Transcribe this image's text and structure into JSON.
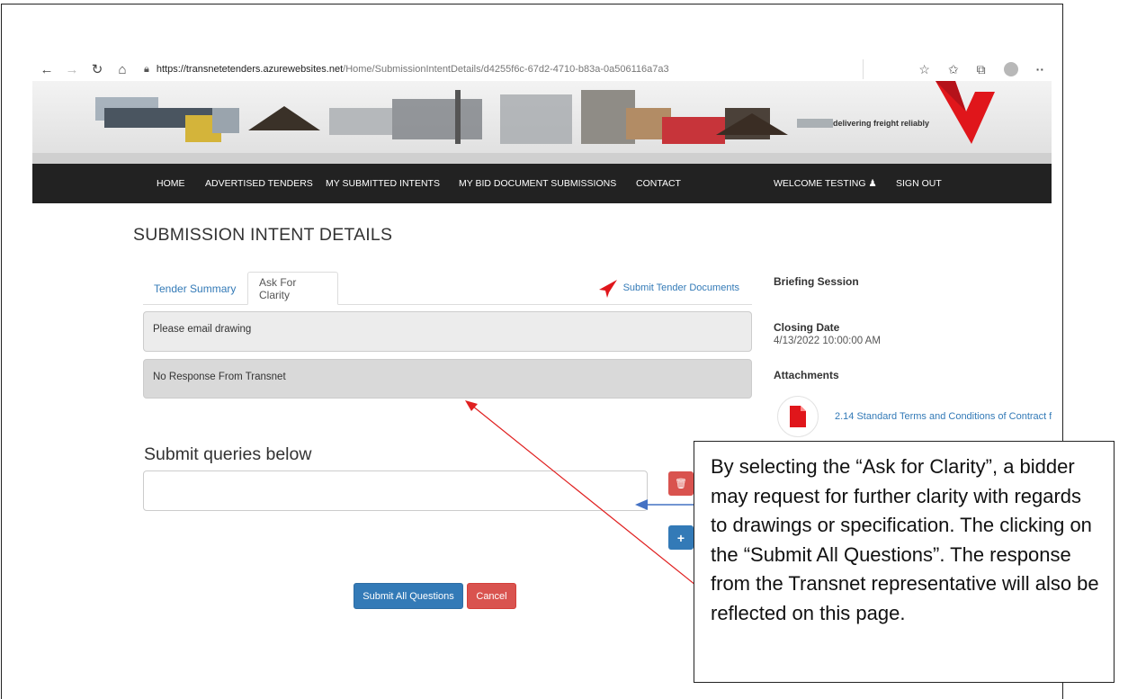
{
  "browser": {
    "url_host": "https://transnetetenders.azurewebsites.net",
    "url_path": "/Home/SubmissionIntentDetails/d4255f6c-67d2-4710-b83a-0a506116a7a3"
  },
  "banner": {
    "tagline": "delivering freight reliably"
  },
  "nav": {
    "home": "HOME",
    "advertised": "ADVERTISED TENDERS",
    "intents": "MY SUBMITTED INTENTS",
    "bid_docs": "MY BID DOCUMENT SUBMISSIONS",
    "contact": "CONTACT",
    "welcome": "WELCOME TESTING",
    "sign_out": "SIGN OUT"
  },
  "page": {
    "title": "SUBMISSION INTENT DETAILS"
  },
  "tabs": {
    "summary": "Tender Summary",
    "clarity": "Ask For Clarity",
    "submit_docs": "Submit Tender Documents"
  },
  "clarity": {
    "question": "Please email drawing",
    "response": "No Response From Transnet",
    "queries_heading": "Submit queries below",
    "submit_all": "Submit All Questions",
    "cancel": "Cancel"
  },
  "sidebar": {
    "briefing": "Briefing Session",
    "closing_label": "Closing Date",
    "closing_date": "4/13/2022 10:00:00 AM",
    "attachments": "Attachments",
    "attachment_name": "2.14 Standard Terms and Conditions of Contract f"
  },
  "callout": {
    "text": "By selecting the “Ask for Clarity”, a bidder may request for further clarity with regards to drawings or specification. The clicking on the “Submit All Questions”. The response from the Transnet representative will also be reflected on this page."
  },
  "colors": {
    "nav_bg": "#222222",
    "link": "#337ab7",
    "danger": "#d9534f",
    "brand_red": "#e0161b"
  }
}
